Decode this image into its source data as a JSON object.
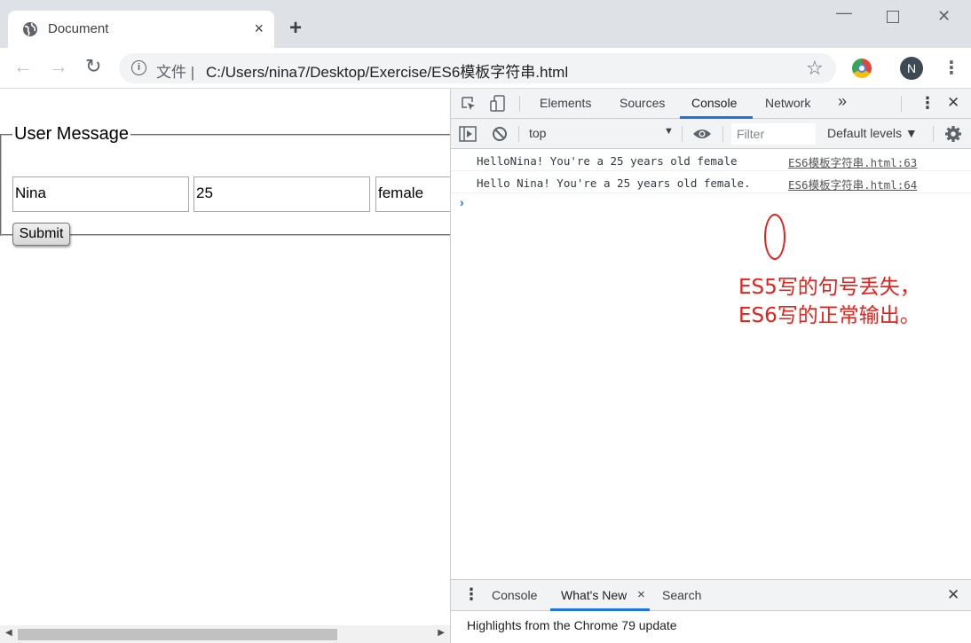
{
  "browser": {
    "tab": {
      "title": "Document",
      "close": "×"
    },
    "new_tab": "+",
    "window_controls": {
      "minimize": "—",
      "close": "✕"
    },
    "nav": {
      "back": "←",
      "forward": "→",
      "reload": "↻"
    },
    "address": {
      "prefix": "文件 |",
      "url": "C:/Users/nina7/Desktop/Exercise/ES6模板字符串.html",
      "info": "i"
    },
    "star": "☆",
    "avatar_letter": "N",
    "menu": "⋮"
  },
  "page": {
    "legend": "User Message",
    "fields": {
      "name": "Nina",
      "age": "25",
      "gender": "female"
    },
    "submit": "Submit",
    "scroll_left": "◀",
    "scroll_right": "▶"
  },
  "devtools": {
    "tabs": [
      "Elements",
      "Sources",
      "Console",
      "Network"
    ],
    "active_tab": "Console",
    "more_tabs": "»",
    "context": "top",
    "context_arrow": "▼",
    "filter_placeholder": "Filter",
    "levels": "Default levels ▼",
    "close": "✕",
    "kebab": "⋮",
    "logs": [
      {
        "message": "HelloNina! You're a 25 years old female",
        "source": "ES6模板字符串.html:63"
      },
      {
        "message": "Hello Nina! You're a 25 years old female.",
        "source": "ES6模板字符串.html:64"
      }
    ],
    "prompt": "›",
    "annotation": {
      "line1": "ES5写的句号丢失，",
      "line2": "ES6写的正常输出。",
      "color": "#e8201a"
    },
    "drawer": {
      "tabs": [
        "Console",
        "What's New",
        "Search"
      ],
      "active_tab": "What's New",
      "active_close": "×",
      "close": "✕",
      "kebab": "⋮",
      "content": "Highlights from the Chrome 79 update"
    },
    "accent_color": "#1a73e8"
  }
}
